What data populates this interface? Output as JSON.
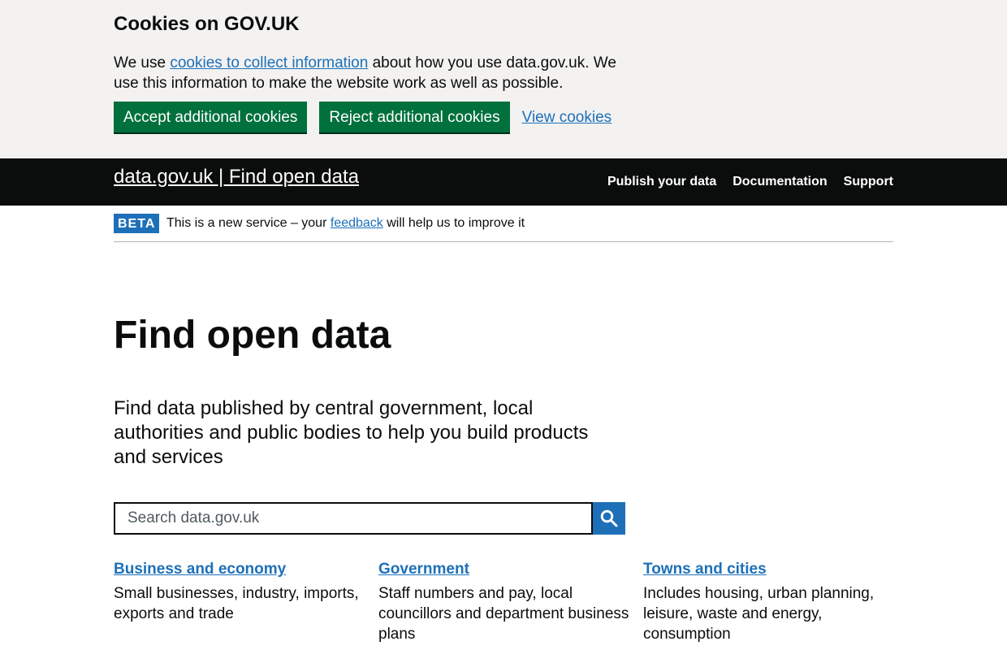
{
  "cookie_banner": {
    "title": "Cookies on GOV.UK",
    "text_before": "We use ",
    "link": "cookies to collect information",
    "text_after": " about how you use data.gov.uk. We use this information to make the website work as well as possible.",
    "accept_label": "Accept additional cookies",
    "reject_label": "Reject additional cookies",
    "view_label": "View cookies"
  },
  "header": {
    "service_name": "data.gov.uk | Find open data",
    "nav": [
      "Publish your data",
      "Documentation",
      "Support"
    ]
  },
  "phase_banner": {
    "tag": "BETA",
    "text_before": "This is a new service – your ",
    "link": "feedback",
    "text_after": " will help us to improve it"
  },
  "main": {
    "heading": "Find open data",
    "lead": "Find data published by central government, local authorities and public bodies to help you build products and services",
    "search": {
      "placeholder": "Search data.gov.uk",
      "button_icon": "search-icon"
    },
    "topics": [
      {
        "title": "Business and economy",
        "description": "Small businesses, industry, imports, exports and trade"
      },
      {
        "title": "Government",
        "description": "Staff numbers and pay, local councillors and department business plans"
      },
      {
        "title": "Towns and cities",
        "description": "Includes housing, urban planning, leisure, waste and energy, consumption"
      }
    ]
  },
  "colors": {
    "link": "#1d70b8",
    "button_green": "#00703c",
    "header_black": "#0b0c0c",
    "banner_grey": "#f3f2f1"
  }
}
